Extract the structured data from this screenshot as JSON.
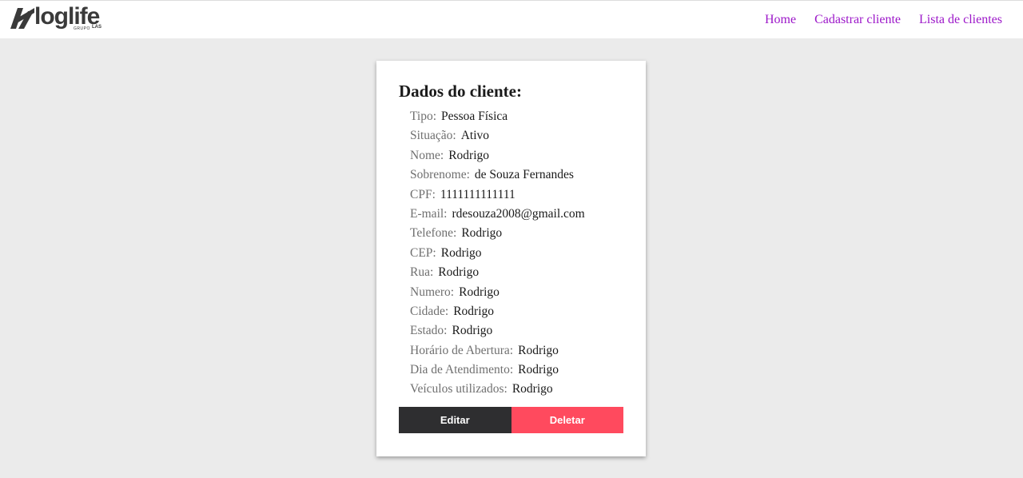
{
  "header": {
    "logo": {
      "word": "loglife",
      "sub": "GRUPO",
      "brand": "LAS"
    },
    "nav": [
      {
        "label": "Home"
      },
      {
        "label": "Cadastrar cliente"
      },
      {
        "label": "Lista de clientes"
      }
    ]
  },
  "card": {
    "title": "Dados do cliente:",
    "fields": [
      {
        "label": "Tipo:",
        "value": "Pessoa Física"
      },
      {
        "label": "Situação:",
        "value": "Ativo"
      },
      {
        "label": "Nome:",
        "value": "Rodrigo"
      },
      {
        "label": "Sobrenome:",
        "value": "de Souza Fernandes"
      },
      {
        "label": "CPF:",
        "value": "1111111111111"
      },
      {
        "label": "E-mail:",
        "value": "rdesouza2008@gmail.com"
      },
      {
        "label": "Telefone:",
        "value": "Rodrigo"
      },
      {
        "label": "CEP:",
        "value": "Rodrigo"
      },
      {
        "label": "Rua:",
        "value": "Rodrigo"
      },
      {
        "label": "Numero:",
        "value": "Rodrigo"
      },
      {
        "label": "Cidade:",
        "value": "Rodrigo"
      },
      {
        "label": "Estado:",
        "value": "Rodrigo"
      },
      {
        "label": "Horário de Abertura:",
        "value": "Rodrigo"
      },
      {
        "label": "Dia de Atendimento:",
        "value": "Rodrigo"
      },
      {
        "label": "Veículos utilizados:",
        "value": "Rodrigo"
      }
    ],
    "actions": {
      "edit_label": "Editar",
      "delete_label": "Deletar"
    }
  },
  "colors": {
    "nav_link": "#9c17c9",
    "edit_button": "#2e2e30",
    "delete_button": "#ff4a5e",
    "background": "#ebebeb"
  }
}
